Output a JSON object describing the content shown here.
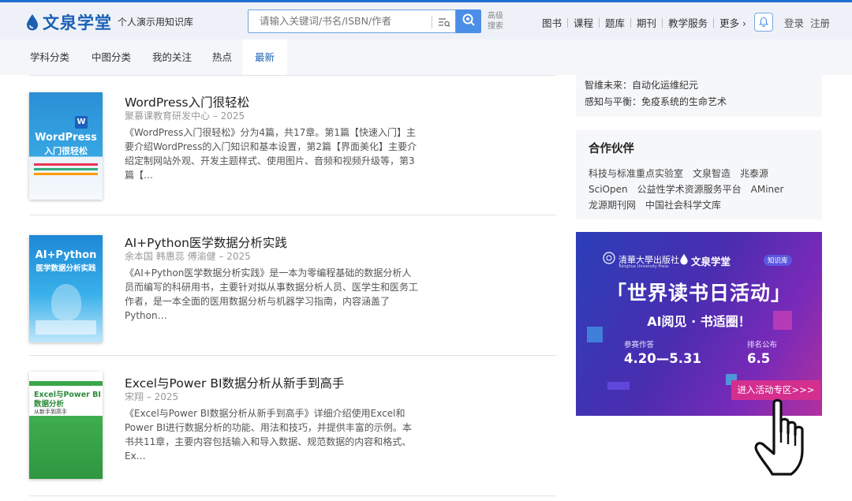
{
  "brand": {
    "name": "文泉学堂",
    "tagline": "个人演示用知识库",
    "primary_color": "#1a5fb4",
    "accent_color": "#4b8ee8"
  },
  "search": {
    "placeholder": "请输入关键词/书名/ISBN/作者",
    "advanced_label": "高级搜索"
  },
  "nav": {
    "items": [
      "图书",
      "课程",
      "题库",
      "期刊",
      "教学服务",
      "更多 ›"
    ],
    "login": "登录",
    "register": "注册"
  },
  "tabs": [
    {
      "label": "学科分类",
      "active": false
    },
    {
      "label": "中图分类",
      "active": false
    },
    {
      "label": "我的关注",
      "active": false
    },
    {
      "label": "热点",
      "active": false
    },
    {
      "label": "最新",
      "active": true
    }
  ],
  "books": [
    {
      "title": "WordPress入门很轻松",
      "meta": "聚慕课教育研发中心 – 2025",
      "desc": "《WordPress入门很轻松》分为4篇，共17章。第1篇【快速入门】主要介绍WordPress的入门知识和基本设置，第2篇【界面美化】主要介绍定制网站外观、开发主题样式、使用图片、音频和视频升级等，第3篇【…",
      "cover_title": "WordPress",
      "cover_sub": "入门很轻松"
    },
    {
      "title": "AI+Python医学数据分析实践",
      "meta": "余本国 韩惠蕊 傅渝健 – 2025",
      "desc": "《AI+Python医学数据分析实践》是一本为零编程基础的数据分析人员而编写的科研用书，主要针对拟从事数据分析人员、医学生和医务工作者，是一本全面的医用数据分析与机器学习指南，内容涵盖了Python…",
      "cover_title": "AI+Python",
      "cover_sub": "医学数据分析实践"
    },
    {
      "title": "Excel与Power BI数据分析从新手到高手",
      "meta": "宋翔 – 2025",
      "desc": "《Excel与Power BI数据分析从新手到高手》详细介绍使用Excel和Power BI进行数据分析的功能、用法和技巧，并提供丰富的示例。本书共11章，主要内容包括输入和导入数据、规范数据的内容和格式、Ex…",
      "cover_title": "Excel与Power BI",
      "cover_sub": "数据分析",
      "cover_sub2": "从新手到高手"
    }
  ],
  "sidebar": {
    "topics": [
      "智维未来：自动化运维纪元",
      "感知与平衡：免疫系统的生命艺术"
    ],
    "partners_title": "合作伙伴",
    "partners": [
      "科技与标准重点实验室",
      "文泉智造",
      "兆泰源",
      "SciOpen",
      "公益性学术资源服务平台",
      "AMiner",
      "龙源期刊网",
      "中国社会科学文库"
    ]
  },
  "banner": {
    "publisher": "清華大學出版社",
    "publisher_en": "Tsinghua University Press",
    "logo": "文泉学堂",
    "kb_badge": "知识库",
    "headline": "「世界读书日活动」",
    "subline": "AI阅见 · 书适圈！",
    "label1": "参赛作答",
    "dates1": "4.20—5.31",
    "label2": "排名公布",
    "dates2": "6.5",
    "cta": "进入活动专区>>>",
    "bg_start": "#2b3fb8",
    "bg_end": "#b3309e",
    "cta_color": "#d42f8f"
  }
}
